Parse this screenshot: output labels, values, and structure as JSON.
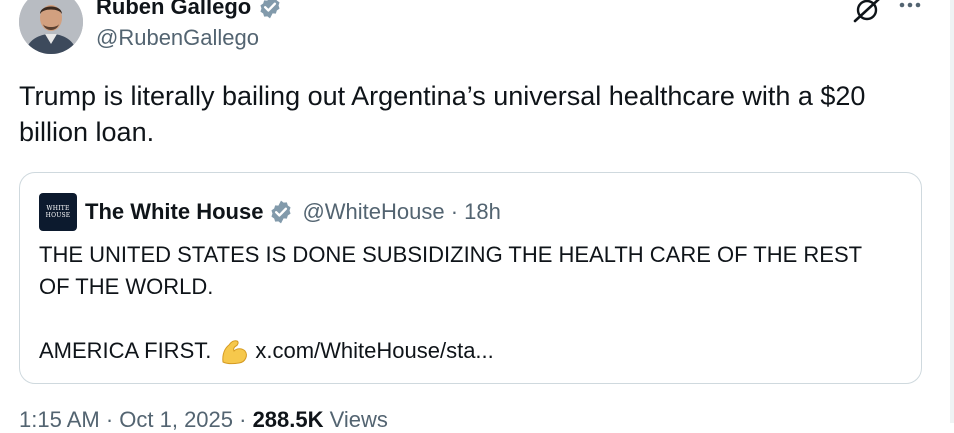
{
  "author": {
    "name": "Ruben Gallego",
    "handle": "@RubenGallego",
    "verified": true
  },
  "icons": {
    "avatar": "person-photo",
    "verified_badge": "verified-badge-icon",
    "grok": "grok-icon",
    "more": "more-icon",
    "flexed_biceps": "flexed-biceps-emoji"
  },
  "tweet": {
    "text": "Trump is literally bailing out Argentina’s universal healthcare with a $20 billion loan."
  },
  "quoted_tweet": {
    "avatar_text": "WHITE HOUSE",
    "name": "The White House",
    "handle_time": "@WhiteHouse · 18h",
    "line1": "THE UNITED STATES IS DONE SUBSIDIZING THE HEALTH CARE OF THE REST",
    "line2": "OF THE WORLD.",
    "line3": "AMERICA FIRST.",
    "link": "x.com/WhiteHouse/sta..."
  },
  "meta": {
    "time": "1:15 AM · Oct 1, 2025 · ",
    "views_count": "288.5K",
    "views_label": " Views"
  },
  "colors": {
    "text_primary": "#0f1419",
    "text_secondary": "#536471",
    "verified_gray": "#829aab",
    "border": "#cfd9de"
  }
}
